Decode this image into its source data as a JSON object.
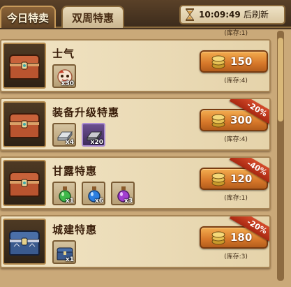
{
  "tabs": [
    {
      "label": "今日特卖",
      "active": true
    },
    {
      "label": "双周特惠",
      "active": false
    }
  ],
  "timer": {
    "time": "10:09:49",
    "refresh_label": "后刷新",
    "icon": "hourglass-icon"
  },
  "list": {
    "top_stock": "(库存:1)",
    "rows": [
      {
        "title": "士气",
        "chest": "orange-chest-icon",
        "items": [
          {
            "icon": "morale-mascot-icon",
            "qty": "x30"
          }
        ],
        "price": "150",
        "stock": "(库存:4)",
        "discount": ""
      },
      {
        "title": "装备升级特惠",
        "chest": "orange-chest-icon",
        "items": [
          {
            "icon": "silver-ingot-icon",
            "qty": "x4"
          },
          {
            "icon": "dark-ingot-icon",
            "qty": "x20"
          }
        ],
        "price": "300",
        "stock": "(库存:4)",
        "discount": "-20%"
      },
      {
        "title": "甘露特惠",
        "chest": "orange-chest-icon",
        "items": [
          {
            "icon": "green-potion-icon",
            "qty": "x1"
          },
          {
            "icon": "blue-potion-icon",
            "qty": "x6"
          },
          {
            "icon": "purple-potion-icon",
            "qty": "x3"
          }
        ],
        "price": "120",
        "stock": "(库存:1)",
        "discount": "-40%"
      },
      {
        "title": "城建特惠",
        "chest": "blue-chest-icon",
        "items": [
          {
            "icon": "blue-chest-small-icon",
            "qty": "x1"
          }
        ],
        "price": "180",
        "stock": "(库存:3)",
        "discount": "-20%"
      }
    ]
  },
  "colors": {
    "accent": "#d7782a",
    "ribbon": "#c23a1e",
    "title": "#3a1e0a",
    "panel": "#eadab5"
  }
}
